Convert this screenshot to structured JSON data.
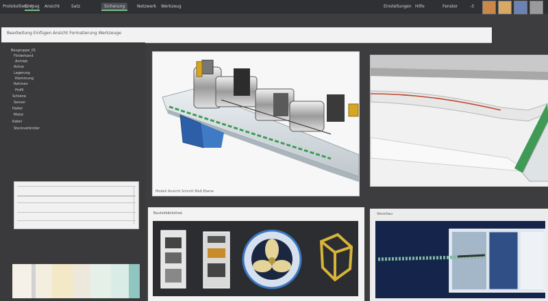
{
  "topbar": {
    "tabs": [
      {
        "label": "Protokollierung"
      },
      {
        "label": "Eintrag"
      },
      {
        "label": "Ansicht"
      },
      {
        "label": "Satz"
      },
      {
        "label": "Sicherung"
      },
      {
        "label": "Netzwerk"
      },
      {
        "label": "Werkzeug"
      }
    ],
    "right_labels": [
      "Einstellungen",
      "Hilfe",
      "Fenster"
    ],
    "window_number": "-3"
  },
  "command_bar": {
    "text": "Bearbeitung  Einfügen  Ansicht  Formatierung  Werkzeuge"
  },
  "left_panel": {
    "tree": [
      "Baugruppe_01",
      "Förderband",
      "Antrieb",
      "Achse",
      "Lagerung",
      "Klemmung",
      "Rahmen",
      "Profil",
      "Schiene",
      "Sensor",
      "Halter",
      "Motor",
      "Kabel",
      "Steckverbinder"
    ]
  },
  "viewport_main": {
    "status": "Modell  Ansicht  Schnitt  Maß  Ebene"
  },
  "bottom_center": {
    "header": "Bauteilbibliothek"
  },
  "bottom_right": {
    "header": "Vorschau"
  },
  "colors": {
    "background": "#3d3d3f",
    "accent_green": "#3f9a55",
    "blue_block": "#2d5fa8",
    "yellow_part": "#d7a521",
    "dark_panel": "#14244a"
  }
}
